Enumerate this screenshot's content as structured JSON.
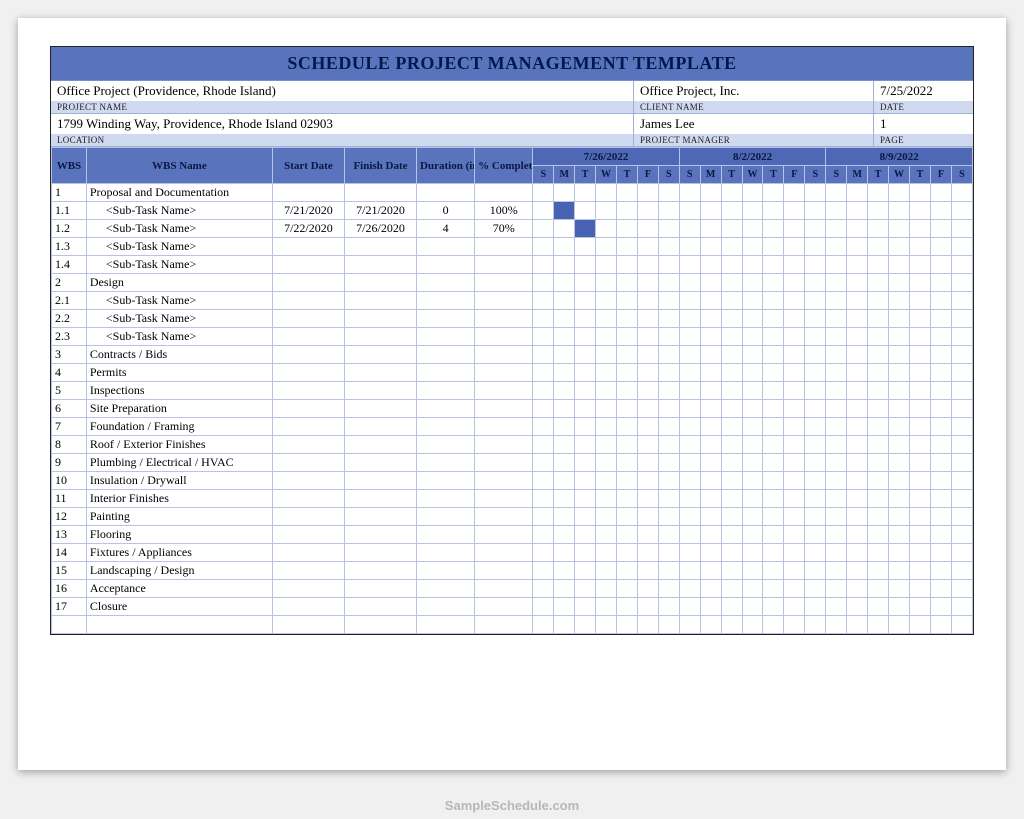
{
  "title": "SCHEDULE PROJECT MANAGEMENT  TEMPLATE",
  "meta": {
    "project_name": {
      "value": "Office Project (Providence, Rhode Island)",
      "label": "PROJECT NAME"
    },
    "location": {
      "value": "1799  Winding Way, Providence, Rhode Island   02903",
      "label": "LOCATION"
    },
    "client_name": {
      "value": "Office Project, Inc.",
      "label": "CLIENT NAME"
    },
    "project_manager": {
      "value": "James Lee",
      "label": "PROJECT MANAGER"
    },
    "date": {
      "value": "7/25/2022",
      "label": "DATE"
    },
    "page": {
      "value": "1",
      "label": "PAGE"
    }
  },
  "columns": {
    "wbs": "WBS",
    "wbs_name": "WBS Name",
    "start": "Start Date",
    "finish": "Finish Date",
    "duration": "Duration (in Day)",
    "pct": "% Completed"
  },
  "weeks": [
    "7/26/2022",
    "8/2/2022",
    "8/9/2022"
  ],
  "days": [
    "S",
    "M",
    "T",
    "W",
    "T",
    "F",
    "S"
  ],
  "rows": [
    {
      "wbs": "1",
      "name": "Proposal and Documentation",
      "start": "",
      "finish": "",
      "dur": "",
      "pct": "",
      "indent": 0,
      "fill": []
    },
    {
      "wbs": "1.1",
      "name": "<Sub-Task Name>",
      "start": "7/21/2020",
      "finish": "7/21/2020",
      "dur": "0",
      "pct": "100%",
      "indent": 1,
      "fill": [
        1
      ]
    },
    {
      "wbs": "1.2",
      "name": "<Sub-Task Name>",
      "start": "7/22/2020",
      "finish": "7/26/2020",
      "dur": "4",
      "pct": "70%",
      "indent": 1,
      "fill": [
        2
      ]
    },
    {
      "wbs": "1.3",
      "name": "<Sub-Task Name>",
      "start": "",
      "finish": "",
      "dur": "",
      "pct": "",
      "indent": 1,
      "fill": []
    },
    {
      "wbs": "1.4",
      "name": "<Sub-Task Name>",
      "start": "",
      "finish": "",
      "dur": "",
      "pct": "",
      "indent": 1,
      "fill": []
    },
    {
      "wbs": "2",
      "name": "Design",
      "start": "",
      "finish": "",
      "dur": "",
      "pct": "",
      "indent": 0,
      "fill": []
    },
    {
      "wbs": "2.1",
      "name": "<Sub-Task Name>",
      "start": "",
      "finish": "",
      "dur": "",
      "pct": "",
      "indent": 1,
      "fill": []
    },
    {
      "wbs": "2.2",
      "name": "<Sub-Task Name>",
      "start": "",
      "finish": "",
      "dur": "",
      "pct": "",
      "indent": 1,
      "fill": []
    },
    {
      "wbs": "2.3",
      "name": "<Sub-Task Name>",
      "start": "",
      "finish": "",
      "dur": "",
      "pct": "",
      "indent": 1,
      "fill": []
    },
    {
      "wbs": "3",
      "name": "Contracts / Bids",
      "start": "",
      "finish": "",
      "dur": "",
      "pct": "",
      "indent": 0,
      "fill": []
    },
    {
      "wbs": "4",
      "name": "Permits",
      "start": "",
      "finish": "",
      "dur": "",
      "pct": "",
      "indent": 0,
      "fill": []
    },
    {
      "wbs": "5",
      "name": "Inspections",
      "start": "",
      "finish": "",
      "dur": "",
      "pct": "",
      "indent": 0,
      "fill": []
    },
    {
      "wbs": "6",
      "name": "Site Preparation",
      "start": "",
      "finish": "",
      "dur": "",
      "pct": "",
      "indent": 0,
      "fill": []
    },
    {
      "wbs": "7",
      "name": "Foundation / Framing",
      "start": "",
      "finish": "",
      "dur": "",
      "pct": "",
      "indent": 0,
      "fill": []
    },
    {
      "wbs": "8",
      "name": "Roof / Exterior Finishes",
      "start": "",
      "finish": "",
      "dur": "",
      "pct": "",
      "indent": 0,
      "fill": []
    },
    {
      "wbs": "9",
      "name": "Plumbing / Electrical / HVAC",
      "start": "",
      "finish": "",
      "dur": "",
      "pct": "",
      "indent": 0,
      "fill": []
    },
    {
      "wbs": "10",
      "name": "Insulation / Drywall",
      "start": "",
      "finish": "",
      "dur": "",
      "pct": "",
      "indent": 0,
      "fill": []
    },
    {
      "wbs": "11",
      "name": "Interior Finishes",
      "start": "",
      "finish": "",
      "dur": "",
      "pct": "",
      "indent": 0,
      "fill": []
    },
    {
      "wbs": "12",
      "name": "Painting",
      "start": "",
      "finish": "",
      "dur": "",
      "pct": "",
      "indent": 0,
      "fill": []
    },
    {
      "wbs": "13",
      "name": "Flooring",
      "start": "",
      "finish": "",
      "dur": "",
      "pct": "",
      "indent": 0,
      "fill": []
    },
    {
      "wbs": "14",
      "name": "Fixtures / Appliances",
      "start": "",
      "finish": "",
      "dur": "",
      "pct": "",
      "indent": 0,
      "fill": []
    },
    {
      "wbs": "15",
      "name": "Landscaping / Design",
      "start": "",
      "finish": "",
      "dur": "",
      "pct": "",
      "indent": 0,
      "fill": []
    },
    {
      "wbs": "16",
      "name": "Acceptance",
      "start": "",
      "finish": "",
      "dur": "",
      "pct": "",
      "indent": 0,
      "fill": []
    },
    {
      "wbs": "17",
      "name": "Closure",
      "start": "",
      "finish": "",
      "dur": "",
      "pct": "",
      "indent": 0,
      "fill": []
    }
  ],
  "watermark": "SampleSchedule.com"
}
